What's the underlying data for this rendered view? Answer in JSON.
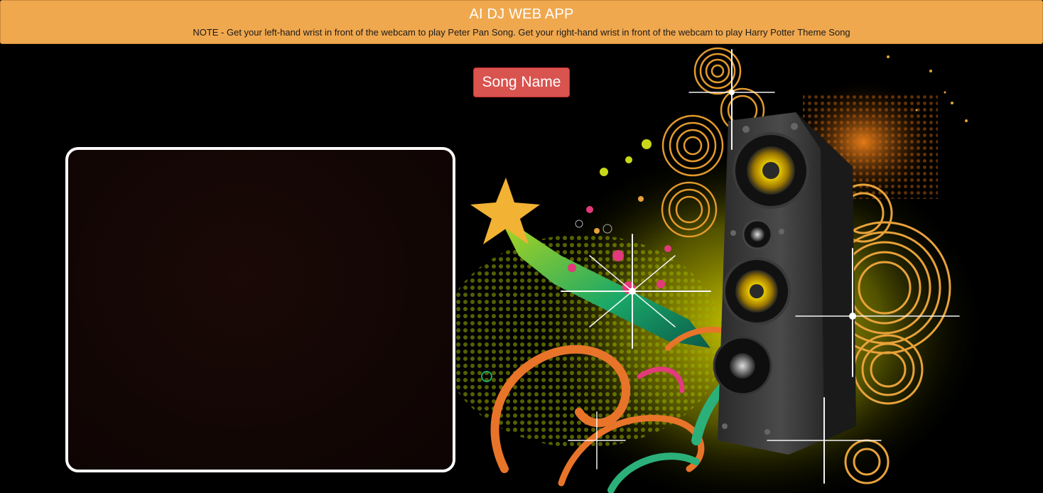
{
  "header": {
    "title": "AI DJ WEB APP",
    "note": "NOTE - Get your left-hand wrist in front of the webcam to play Peter Pan Song. Get your right-hand wrist in front of the webcam to play Harry Potter Theme Song"
  },
  "song_button": {
    "label": "Song Name"
  },
  "colors": {
    "header_bg": "#f0a84e",
    "button_bg": "#d9534f",
    "page_bg": "#000000",
    "webcam_border": "#ffffff"
  },
  "background_art": {
    "icon": "speaker-music-art"
  }
}
